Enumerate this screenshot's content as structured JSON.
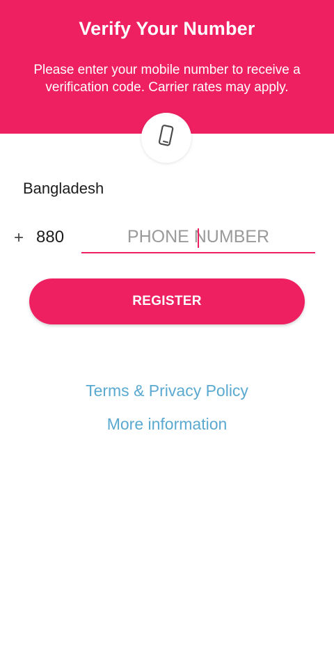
{
  "header": {
    "title": "Verify Your Number",
    "subtitle": "Please enter your mobile number to receive a verification code. Carrier rates may apply.",
    "background_color": "#ee2062",
    "icon": "smartphone-icon"
  },
  "form": {
    "country": "Bangladesh",
    "plus_sign": "+",
    "country_code": "880",
    "phone_placeholder": "PHONE NUMBER",
    "phone_value": "",
    "register_label": "REGISTER"
  },
  "links": {
    "terms": "Terms & Privacy Policy",
    "more_info": "More information",
    "link_color": "#5aa9d0"
  }
}
